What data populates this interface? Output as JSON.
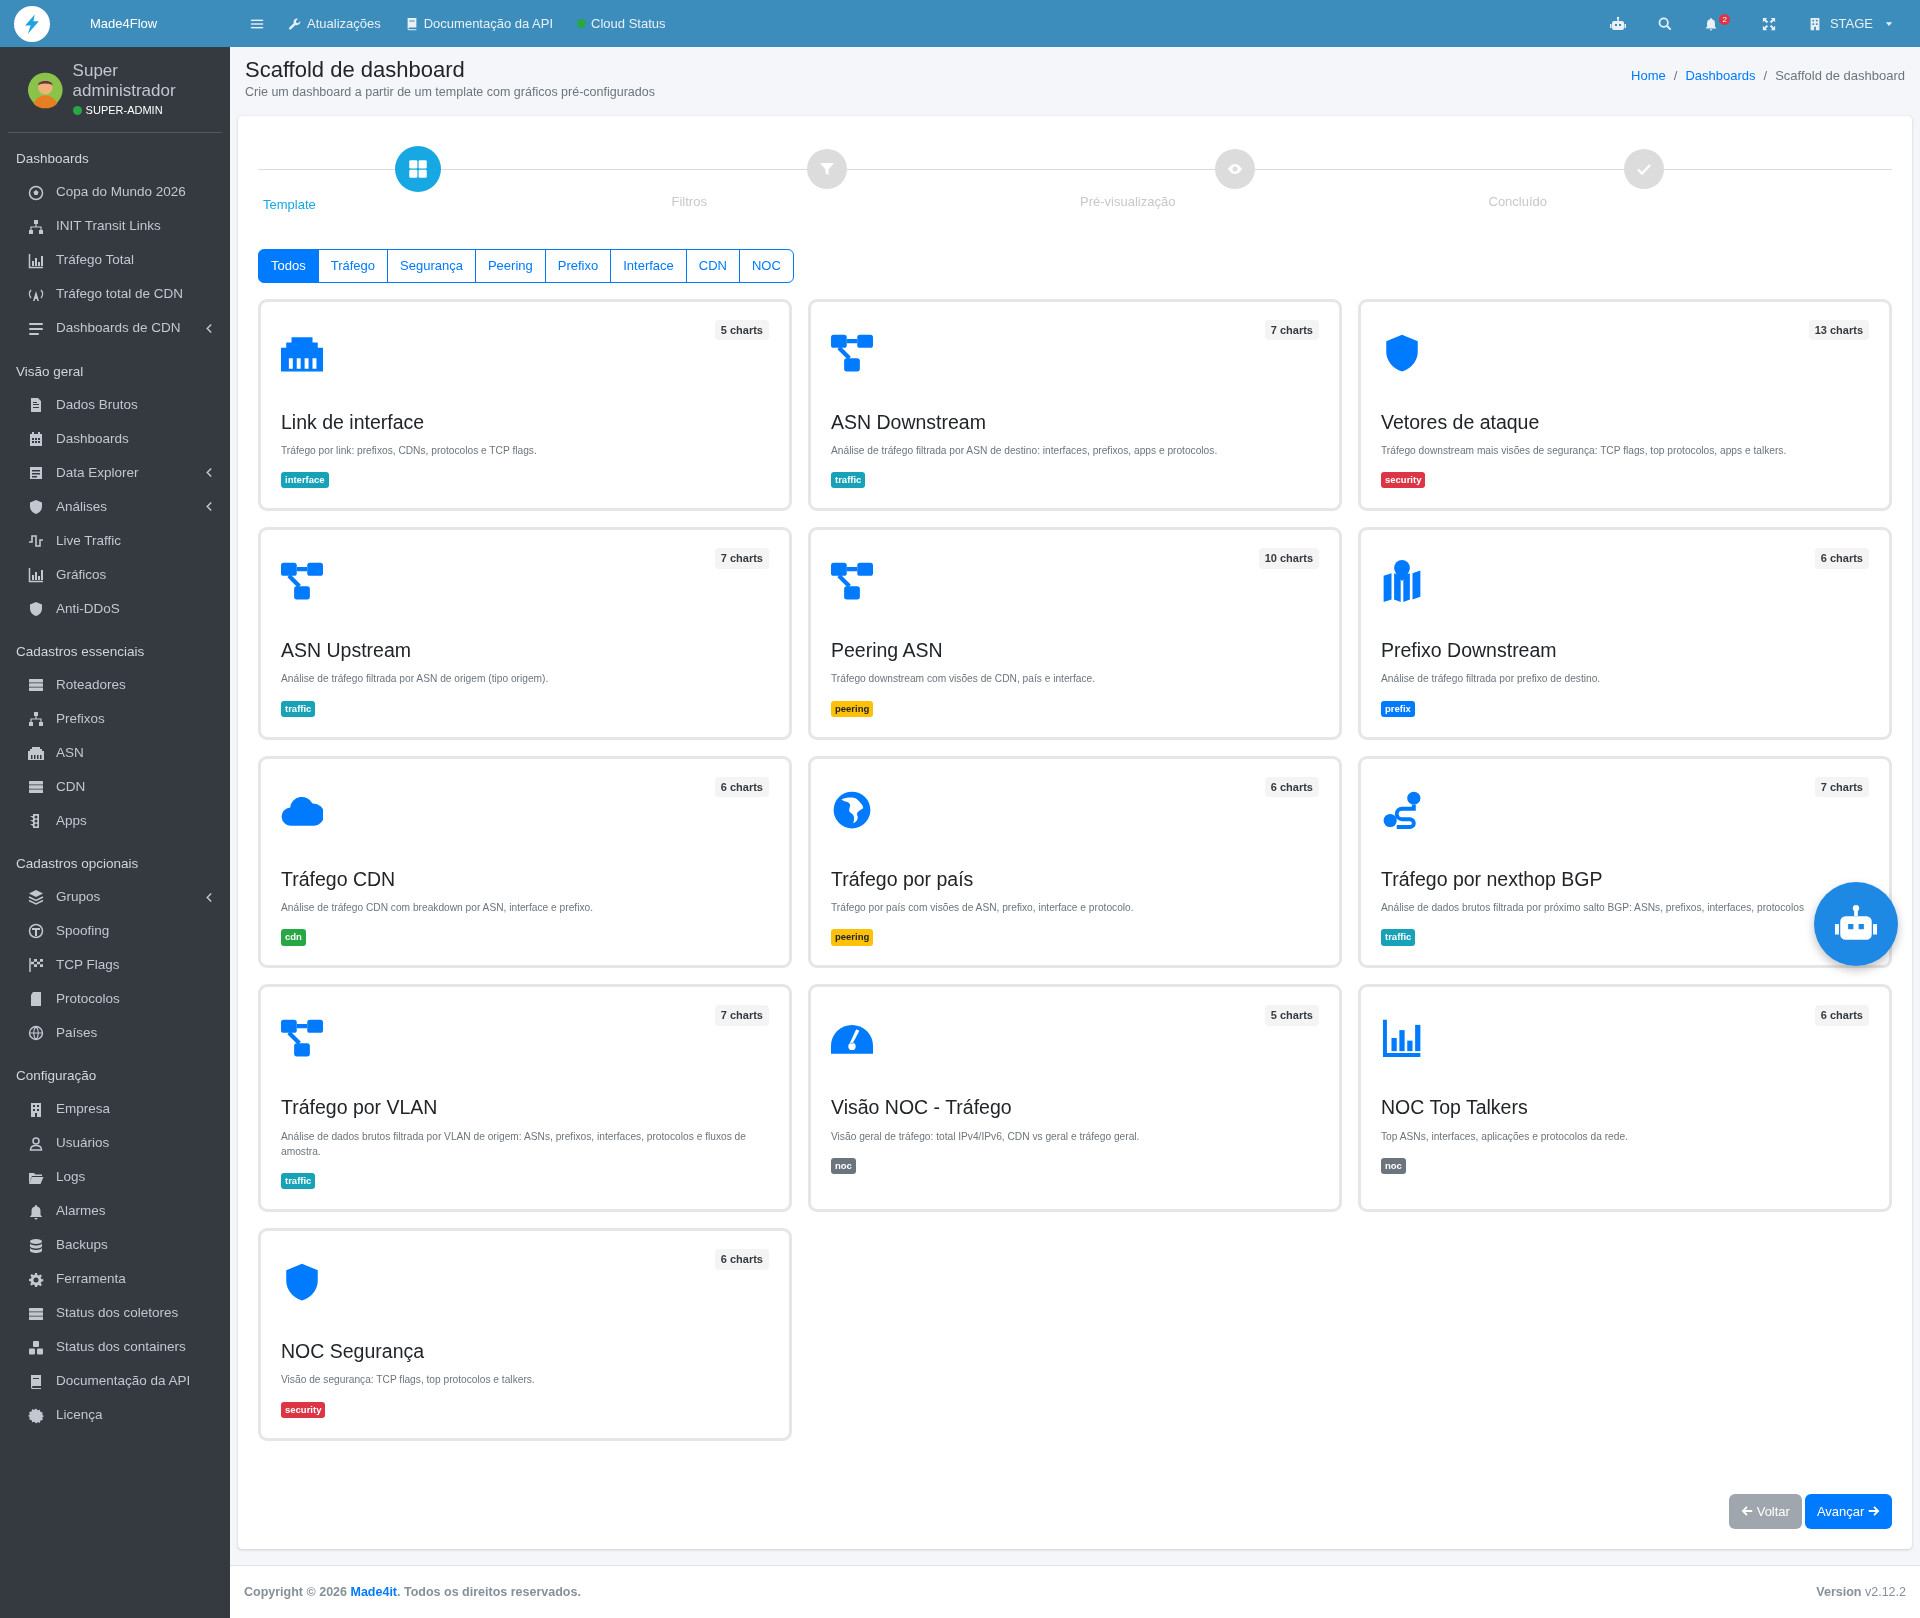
{
  "brand": {
    "name": "Made4Flow"
  },
  "user": {
    "name": "Super administrador",
    "role": "SUPER-ADMIN",
    "online": true
  },
  "sidebar": [
    {
      "header": "Dashboards",
      "items": [
        {
          "label": "Copa do Mundo 2026",
          "submenu": false
        },
        {
          "label": "INIT Transit Links",
          "submenu": false
        },
        {
          "label": "Tráfego Total",
          "submenu": false
        },
        {
          "label": "Tráfego total de CDN",
          "submenu": false
        },
        {
          "label": "Dashboards de CDN",
          "submenu": true
        }
      ]
    },
    {
      "header": "Visão geral",
      "items": [
        {
          "label": "Dados Brutos",
          "submenu": false
        },
        {
          "label": "Dashboards",
          "submenu": false
        },
        {
          "label": "Data Explorer",
          "submenu": true
        },
        {
          "label": "Análises",
          "submenu": true
        },
        {
          "label": "Live Traffic",
          "submenu": false
        },
        {
          "label": "Gráficos",
          "submenu": false
        },
        {
          "label": "Anti-DDoS",
          "submenu": false
        }
      ]
    },
    {
      "header": "Cadastros essenciais",
      "items": [
        {
          "label": "Roteadores",
          "submenu": false
        },
        {
          "label": "Prefixos",
          "submenu": false
        },
        {
          "label": "ASN",
          "submenu": false
        },
        {
          "label": "CDN",
          "submenu": false
        },
        {
          "label": "Apps",
          "submenu": false
        }
      ]
    },
    {
      "header": "Cadastros opcionais",
      "items": [
        {
          "label": "Grupos",
          "submenu": true
        },
        {
          "label": "Spoofing",
          "submenu": false
        },
        {
          "label": "TCP Flags",
          "submenu": false
        },
        {
          "label": "Protocolos",
          "submenu": false
        },
        {
          "label": "Países",
          "submenu": false
        }
      ]
    },
    {
      "header": "Configuração",
      "items": [
        {
          "label": "Empresa",
          "submenu": false
        },
        {
          "label": "Usuários",
          "submenu": false
        },
        {
          "label": "Logs",
          "submenu": false
        },
        {
          "label": "Alarmes",
          "submenu": false
        },
        {
          "label": "Backups",
          "submenu": false
        },
        {
          "label": "Ferramenta",
          "submenu": false
        },
        {
          "label": "Status dos coletores",
          "submenu": false
        },
        {
          "label": "Status dos containers",
          "submenu": false
        },
        {
          "label": "Documentação da API",
          "submenu": false
        },
        {
          "label": "Licença",
          "submenu": false
        }
      ]
    }
  ],
  "topbar": {
    "links": [
      {
        "label": "Atualizações"
      },
      {
        "label": "Documentação da API"
      },
      {
        "label": "Cloud Status",
        "online": true
      }
    ],
    "notifications": "2",
    "environment": "STAGE"
  },
  "header": {
    "title": "Scaffold de dashboard",
    "subtitle": "Crie um dashboard a partir de um template com gráficos pré-configurados",
    "breadcrumb_separator": "/",
    "breadcrumb": [
      {
        "label": "Home",
        "current": false
      },
      {
        "label": "Dashboards",
        "current": false
      },
      {
        "label": "Scaffold de dashboard",
        "current": true
      }
    ]
  },
  "steps": [
    {
      "label": "Template",
      "selected": true
    },
    {
      "label": "Filtros",
      "selected": false
    },
    {
      "label": "Pré-visualização",
      "selected": false
    },
    {
      "label": "Concluído",
      "selected": false
    }
  ],
  "filters": [
    {
      "label": "Todos",
      "selected": true
    },
    {
      "label": "Tráfego",
      "selected": false
    },
    {
      "label": "Segurança",
      "selected": false
    },
    {
      "label": "Peering",
      "selected": false
    },
    {
      "label": "Prefixo",
      "selected": false
    },
    {
      "label": "Interface",
      "selected": false
    },
    {
      "label": "CDN",
      "selected": false
    },
    {
      "label": "NOC",
      "selected": false
    }
  ],
  "templates": [
    {
      "title": "Link de interface",
      "charts": "5 charts",
      "description": "Tráfego por link: prefixos, CDNs, protocolos e TCP flags.",
      "tag": "interface",
      "color": "#17a2b8"
    },
    {
      "title": "ASN Downstream",
      "charts": "7 charts",
      "description": "Análise de tráfego filtrada por ASN de destino: interfaces, prefixos, apps e protocolos.",
      "tag": "traffic",
      "color": "#17a2b8"
    },
    {
      "title": "Vetores de ataque",
      "charts": "13 charts",
      "description": "Tráfego downstream mais visões de segurança: TCP flags, top protocolos, apps e talkers.",
      "tag": "security",
      "color": "#dc3545"
    },
    {
      "title": "ASN Upstream",
      "charts": "7 charts",
      "description": "Análise de tráfego filtrada por ASN de origem (tipo origem).",
      "tag": "traffic",
      "color": "#17a2b8"
    },
    {
      "title": "Peering ASN",
      "charts": "10 charts",
      "description": "Tráfego downstream com visões de CDN, país e interface.",
      "tag": "peering",
      "color": "#ffc107"
    },
    {
      "title": "Prefixo Downstream",
      "charts": "6 charts",
      "description": "Análise de tráfego filtrada por prefixo de destino.",
      "tag": "prefix",
      "color": "#007bff"
    },
    {
      "title": "Tráfego CDN",
      "charts": "6 charts",
      "description": "Análise de tráfego CDN com breakdown por ASN, interface e prefixo.",
      "tag": "cdn",
      "color": "#28a745"
    },
    {
      "title": "Tráfego por país",
      "charts": "6 charts",
      "description": "Tráfego por país com visões de ASN, prefixo, interface e protocolo.",
      "tag": "peering",
      "color": "#ffc107"
    },
    {
      "title": "Tráfego por nexthop BGP",
      "charts": "7 charts",
      "description": "Análise de dados brutos filtrada por próximo salto BGP: ASNs, prefixos, interfaces, protocolos",
      "tag": "traffic",
      "color": "#17a2b8"
    },
    {
      "title": "Tráfego por VLAN",
      "charts": "7 charts",
      "description": "Análise de dados brutos filtrada por VLAN de origem: ASNs, prefixos, interfaces, protocolos e fluxos de amostra.",
      "tag": "traffic",
      "color": "#17a2b8"
    },
    {
      "title": "Visão NOC - Tráfego",
      "charts": "5 charts",
      "description": "Visão geral de tráfego: total IPv4/IPv6, CDN vs geral e tráfego geral.",
      "tag": "noc",
      "color": "#6c757d"
    },
    {
      "title": "NOC Top Talkers",
      "charts": "6 charts",
      "description": "Top ASNs, interfaces, aplicações e protocolos da rede.",
      "tag": "noc",
      "color": "#6c757d"
    },
    {
      "title": "NOC Segurança",
      "charts": "6 charts",
      "description": "Visão de segurança: TCP flags, top protocolos e talkers.",
      "tag": "security",
      "color": "#dc3545"
    }
  ],
  "actions": [
    {
      "label": "Voltar",
      "disabled": true
    },
    {
      "label": "Avançar",
      "disabled": false
    }
  ],
  "footer": {
    "copyright": "Copyright © 2026",
    "company": "Made4it",
    "rights": ". Todos os direitos reservados.",
    "version": "**Version** v2.12.2"
  }
}
